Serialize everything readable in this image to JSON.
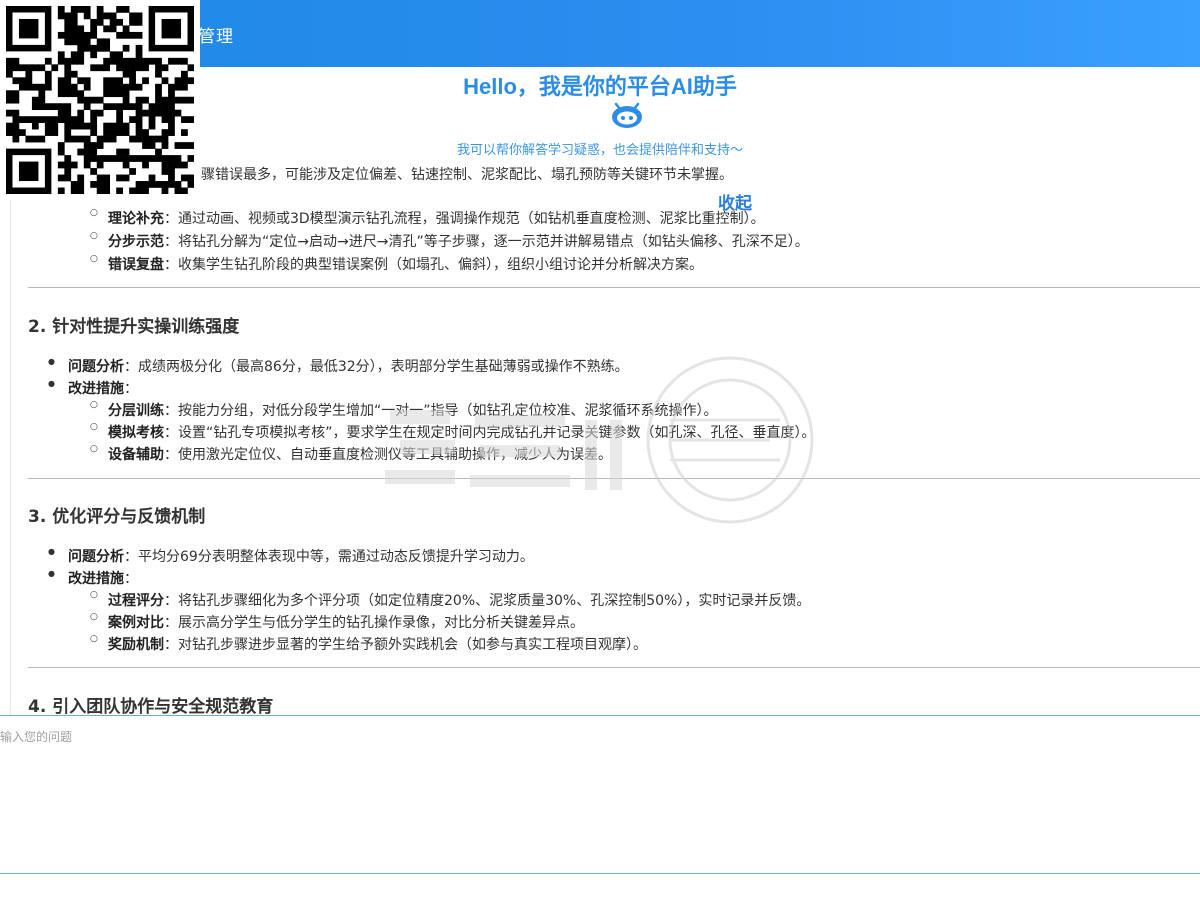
{
  "header": {
    "title": "管理"
  },
  "hero": {
    "title": "Hello，我是你的平台AI助手",
    "subtitle": "我可以帮你解答学习疑惑，也会提供陪伴和支持～"
  },
  "collapse_label": "收起",
  "content": {
    "partial_top": "骤错误最多，可能涉及定位偏差、钻速控制、泥浆配比、塌孔预防等关键环节未掌握。",
    "sec1_items": [
      {
        "label": "理论补充",
        "text": "：通过动画、视频或3D模型演示钻孔流程，强调操作规范（如钻机垂直度检测、泥浆比重控制）。"
      },
      {
        "label": "分步示范",
        "text": "：将钻孔分解为“定位→启动→进尺→清孔”等子步骤，逐一示范并讲解易错点（如钻头偏移、孔深不足）。"
      },
      {
        "label": "错误复盘",
        "text": "：收集学生钻孔阶段的典型错误案例（如塌孔、偏斜），组织小组讨论并分析解决方案。"
      }
    ],
    "sec2": {
      "title": "2. 针对性提升实操训练强度",
      "analysis_label": "问题分析",
      "analysis_text": "：成绩两极分化（最高86分，最低32分），表明部分学生基础薄弱或操作不熟练。",
      "measures_label": "改进措施",
      "items": [
        {
          "label": "分层训练",
          "text": "：按能力分组，对低分段学生增加“一对一”指导（如钻孔定位校准、泥浆循环系统操作）。"
        },
        {
          "label": "模拟考核",
          "text": "：设置“钻孔专项模拟考核”，要求学生在规定时间内完成钻孔并记录关键参数（如孔深、孔径、垂直度）。"
        },
        {
          "label": "设备辅助",
          "text": "：使用激光定位仪、自动垂直度检测仪等工具辅助操作，减少人为误差。"
        }
      ]
    },
    "sec3": {
      "title": "3. 优化评分与反馈机制",
      "analysis_label": "问题分析",
      "analysis_text": "：平均分69分表明整体表现中等，需通过动态反馈提升学习动力。",
      "measures_label": "改进措施",
      "items": [
        {
          "label": "过程评分",
          "text": "：将钻孔步骤细化为多个评分项（如定位精度20%、泥浆质量30%、孔深控制50%），实时记录并反馈。"
        },
        {
          "label": "案例对比",
          "text": "：展示高分学生与低分学生的钻孔操作录像，对比分析关键差异点。"
        },
        {
          "label": "奖励机制",
          "text": "：对钻孔步骤进步显著的学生给予额外实践机会（如参与真实工程项目观摩）。"
        }
      ]
    },
    "sec4": {
      "title": "4. 引入团队协作与安全规范教育"
    }
  },
  "input": {
    "placeholder": "输入您的问题"
  },
  "colors": {
    "header": "#2b8ef0",
    "accent": "#2b8de6",
    "text": "#333333"
  },
  "icons": {
    "robot": "robot-icon",
    "qr": "qr-code"
  }
}
